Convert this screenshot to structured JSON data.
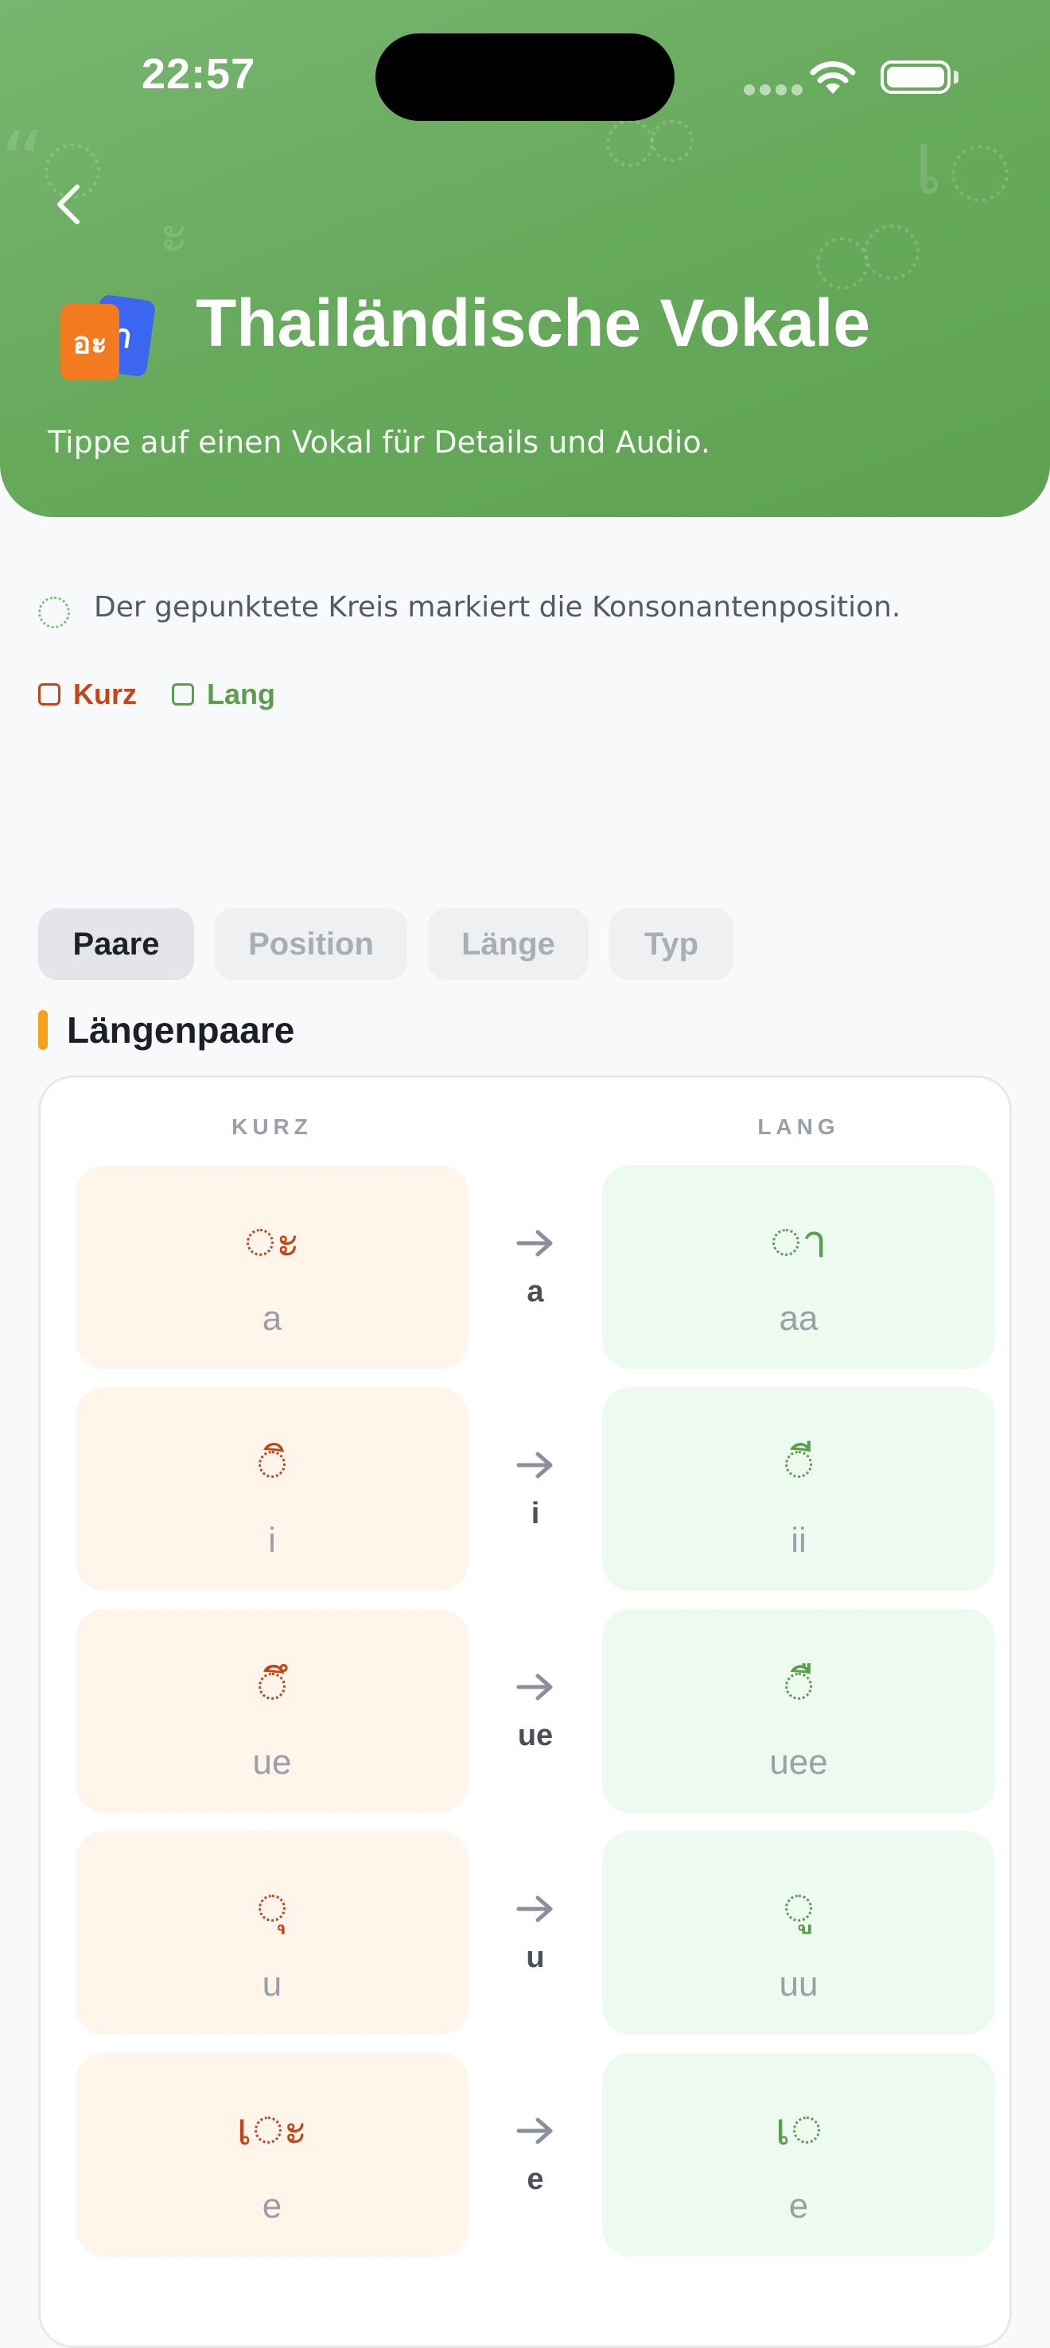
{
  "status_bar": {
    "time": "22:57"
  },
  "header": {
    "title": "Thailändische Vokale",
    "subtitle": "Tippe auf einen Vokal für Details und Audio.",
    "icon_front_glyph": "อะ",
    "icon_back_glyph": "า"
  },
  "info": {
    "text": "Der gepunktete Kreis markiert die Konsonantenposition."
  },
  "legend": {
    "short_label": "Kurz",
    "long_label": "Lang",
    "short_color": "#C2461A",
    "long_color": "#5A9E4E"
  },
  "tabs": [
    {
      "label": "Paare",
      "active": true
    },
    {
      "label": "Position",
      "active": false
    },
    {
      "label": "Länge",
      "active": false
    },
    {
      "label": "Typ",
      "active": false
    }
  ],
  "section": {
    "title": "Längenpaare"
  },
  "columns": {
    "short": "KURZ",
    "long": "LANG"
  },
  "pairs": [
    {
      "short_pre": "",
      "short_post": "ะ",
      "short_label": "a",
      "arrow_label": "a",
      "long_pre": "",
      "long_post": "า",
      "long_label": "aa"
    },
    {
      "short_pre": "",
      "short_post": "ิ",
      "short_label": "i",
      "arrow_label": "i",
      "long_pre": "",
      "long_post": "ี",
      "long_label": "ii"
    },
    {
      "short_pre": "",
      "short_post": "ึ",
      "short_label": "ue",
      "arrow_label": "ue",
      "long_pre": "",
      "long_post": "ื",
      "long_label": "uee"
    },
    {
      "short_pre": "",
      "short_post": "ุ",
      "short_label": "u",
      "arrow_label": "u",
      "long_pre": "",
      "long_post": "ู",
      "long_label": "uu"
    },
    {
      "short_pre": "เ",
      "short_post": "ะ",
      "short_label": "e",
      "arrow_label": "e",
      "long_pre": "เ",
      "long_post": "",
      "long_label": "e"
    }
  ]
}
